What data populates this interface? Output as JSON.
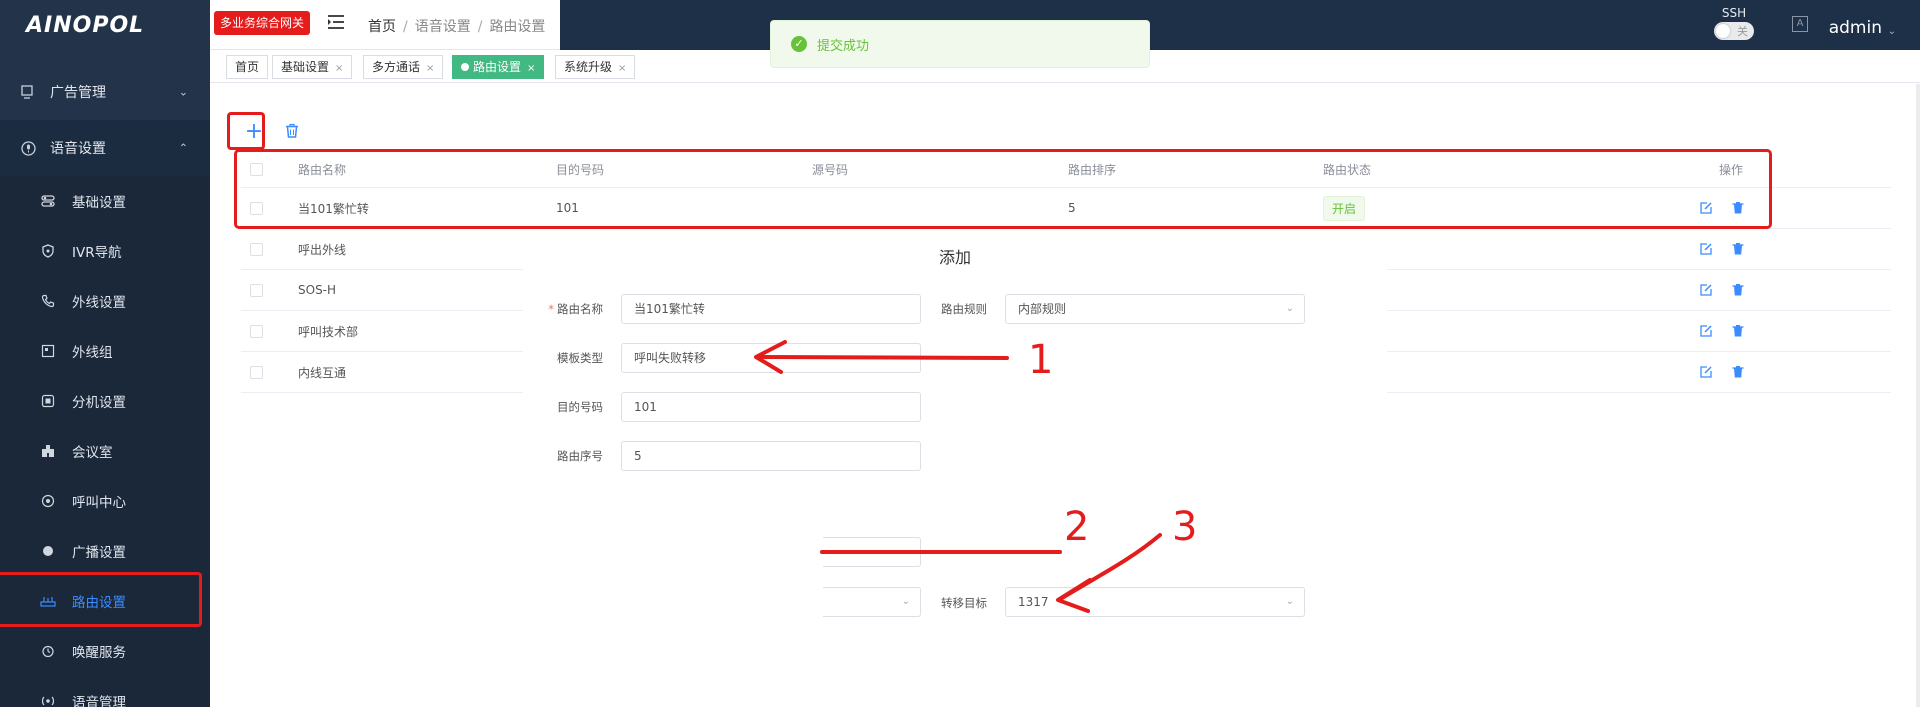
{
  "sidebar": {
    "logo": "AINOPOL",
    "groups": [
      {
        "label": "广告管理",
        "chev": "⌄"
      },
      {
        "label": "语音设置",
        "chev": "⌃"
      }
    ],
    "items": [
      {
        "label": "基础设置"
      },
      {
        "label": "IVR导航"
      },
      {
        "label": "外线设置"
      },
      {
        "label": "外线组"
      },
      {
        "label": "分机设置"
      },
      {
        "label": "会议室"
      },
      {
        "label": "呼叫中心"
      },
      {
        "label": "广播设置"
      },
      {
        "label": "路由设置"
      },
      {
        "label": "唤醒服务"
      },
      {
        "label": "语音管理"
      }
    ]
  },
  "header": {
    "badge": "多业务综合网关",
    "breadcrumb": [
      "首页",
      "语音设置",
      "路由设置"
    ],
    "breadcrumb_sep": "/",
    "ssh_label": "SSH",
    "ssh_toggle": "关",
    "avatar": "A",
    "user": "admin",
    "user_chev": "⌄"
  },
  "tabs": [
    {
      "label": "首页",
      "close": ""
    },
    {
      "label": "基础设置",
      "close": "×"
    },
    {
      "label": "多方通话",
      "close": "×"
    },
    {
      "label": "路由设置",
      "close": "×"
    },
    {
      "label": "系统升级",
      "close": "×"
    }
  ],
  "toast": {
    "text": "提交成功",
    "icon": "✓"
  },
  "toolbar": {
    "add": "+"
  },
  "table": {
    "headers": [
      "路由名称",
      "目的号码",
      "源号码",
      "路由排序",
      "路由状态",
      "操作"
    ],
    "rows": [
      {
        "name": "当101繁忙转",
        "dest": "101",
        "src": "",
        "order": "5",
        "status": "开启"
      },
      {
        "name": "呼出外线"
      },
      {
        "name": "SOS-H"
      },
      {
        "name": "呼叫技术部"
      },
      {
        "name": "内线互通"
      }
    ]
  },
  "dialog": {
    "title": "添加",
    "fields": {
      "route_name": {
        "label": "路由名称",
        "value": "当101繁忙转"
      },
      "route_rule": {
        "label": "路由规则",
        "value": "内部规则"
      },
      "template_type": {
        "label": "模板类型",
        "value": "呼叫失败转移"
      },
      "dest_number": {
        "label": "目的号码",
        "value": "101"
      },
      "route_seq": {
        "label": "路由序号",
        "value": "5"
      },
      "transfer_target": {
        "label": "转移目标",
        "value": "1317"
      }
    }
  },
  "annotations": {
    "n1": "1",
    "n2": "2",
    "n3": "3"
  },
  "colors": {
    "sidebar": "#23344a",
    "accent": "#3b8cff",
    "success": "#42b983",
    "annotation": "#e51c1c"
  }
}
